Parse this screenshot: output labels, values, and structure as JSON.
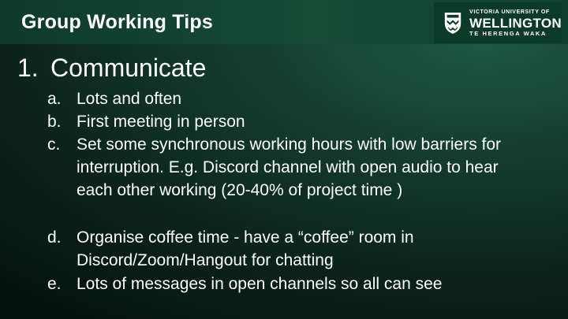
{
  "slide": {
    "title": "Group Working Tips"
  },
  "logo": {
    "line1": "VICTORIA UNIVERSITY OF",
    "line2": "WELLINGTON",
    "line3": "TE HERENGA WAKA",
    "crest_icon": "university-crest-icon"
  },
  "section": {
    "number": "1.",
    "heading": "Communicate"
  },
  "items": [
    {
      "marker": "a.",
      "text": "Lots and often"
    },
    {
      "marker": "b.",
      "text": "First meeting in person"
    },
    {
      "marker": "c.",
      "text": "Set some synchronous working hours with low barriers for interruption. E.g. Discord channel with open audio to hear each other working (20-40% of project time )"
    },
    {
      "marker": "d.",
      "text": "Organise coffee time - have a “coffee” room in Discord/Zoom/Hangout for chatting"
    },
    {
      "marker": "e.",
      "text": "Lots of messages in open channels so all can see"
    }
  ],
  "colors": {
    "background_dark": "#06140f",
    "background_light": "#1f5a45",
    "title_band": "#154a37",
    "text": "#ffffff"
  }
}
